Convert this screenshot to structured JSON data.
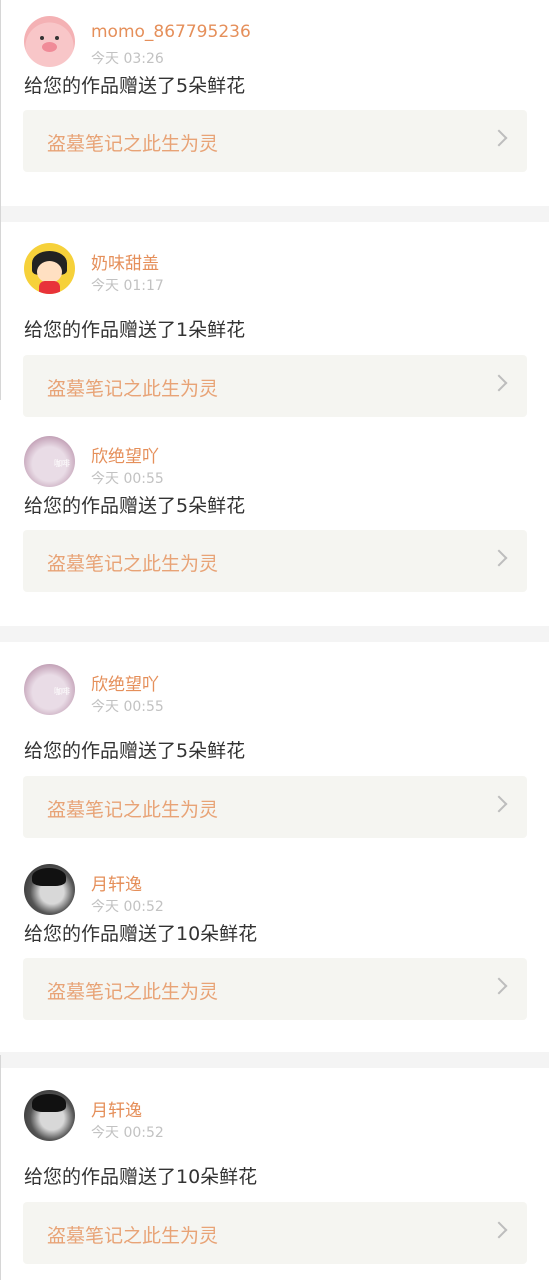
{
  "notifications": [
    {
      "avatar": "pig-cartoon",
      "username": "momo_867795236",
      "time": "今天 03:26",
      "message": "给您的作品赠送了5朵鲜花",
      "work": "盗墓笔记之此生为灵"
    },
    {
      "avatar": "girl-cartoon",
      "username": "奶味甜盖",
      "time": "今天 01:17",
      "message": "给您的作品赠送了1朵鲜花",
      "work": "盗墓笔记之此生为灵"
    },
    {
      "avatar": "cat-photo",
      "username": "欣绝望吖",
      "time": "今天 00:55",
      "message": "给您的作品赠送了5朵鲜花",
      "work": "盗墓笔记之此生为灵"
    },
    {
      "avatar": "cat-photo",
      "username": "欣绝望吖",
      "time": "今天 00:55",
      "message": "给您的作品赠送了5朵鲜花",
      "work": "盗墓笔记之此生为灵"
    },
    {
      "avatar": "man-photo",
      "username": "月轩逸",
      "time": "今天 00:52",
      "message": "给您的作品赠送了10朵鲜花",
      "work": "盗墓笔记之此生为灵"
    },
    {
      "avatar": "man-photo",
      "username": "月轩逸",
      "time": "今天 00:52",
      "message": "给您的作品赠送了10朵鲜花",
      "work": "盗墓笔记之此生为灵"
    }
  ],
  "avatar_tag": "咖啡",
  "colors": {
    "username": "#e58f5a",
    "work_title": "#e8a376",
    "card_bg": "#f5f5f1",
    "time": "#c2c2c2"
  }
}
